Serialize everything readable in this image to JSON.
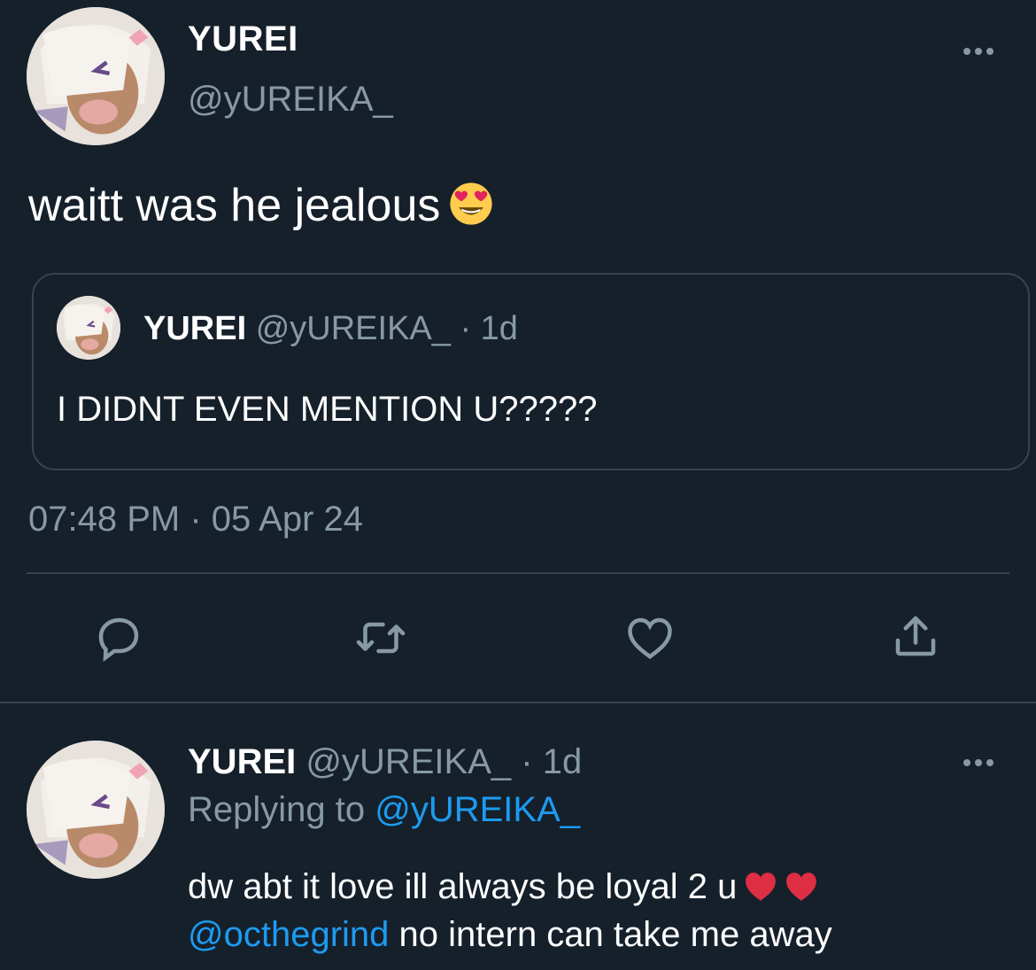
{
  "main_tweet": {
    "display_name": "YUREI",
    "handle": "@yUREIKA_",
    "text": "waitt was he jealous",
    "emoji": "smiling-face-with-heart-eyes",
    "timestamp": "07:48 PM · 05 Apr 24"
  },
  "quoted_tweet": {
    "display_name": "YUREI",
    "handle_meta": "@yUREIKA_ · 1d",
    "text": "I DIDNT EVEN MENTION U?????"
  },
  "actions": [
    "reply-icon",
    "retweet-icon",
    "like-icon",
    "share-icon"
  ],
  "reply_tweet": {
    "display_name": "YUREI",
    "handle_meta": "@yUREIKA_ · 1d",
    "replying_prefix": "Replying to",
    "replying_handle": "@yUREIKA_",
    "text_line1": "dw abt it love ill always be loyal 2 u",
    "mention": "@octhegrind",
    "text_line2": "no intern can take me away",
    "emojis": [
      "red-heart",
      "red-heart"
    ]
  },
  "colors": {
    "background": "#15202b",
    "secondary_text": "#8899a6",
    "border": "#38444d",
    "link": "#1d9bf0"
  }
}
